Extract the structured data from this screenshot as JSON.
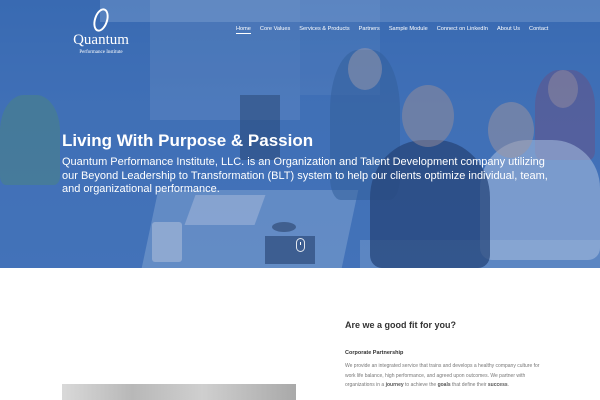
{
  "logo": {
    "name": "Quantum",
    "subtitle": "Performance Institute"
  },
  "nav": {
    "items": [
      {
        "label": "Home",
        "active": true
      },
      {
        "label": "Core Values",
        "active": false
      },
      {
        "label": "Services & Products",
        "active": false
      },
      {
        "label": "Partners",
        "active": false
      },
      {
        "label": "Sample Module",
        "active": false
      },
      {
        "label": "Connect on LinkedIn",
        "active": false
      },
      {
        "label": "About Us",
        "active": false
      },
      {
        "label": "Contact",
        "active": false
      }
    ]
  },
  "hero": {
    "title": "Living With Purpose & Passion",
    "text": "Quantum Performance Institute, LLC. is an Organization and Talent Development company utilizing our Beyond Leadership to Transformation (BLT) system to help our clients optimize individual, team, and organizational performance.",
    "overlay_color": "#2e62b0"
  },
  "fit": {
    "title": "Are we a good fit for you?",
    "subtitle": "Corporate Partnership",
    "body_part1": "We provide an integrated service that trains and develops a healthy company culture for work life balance, high performance, and agreed upon outcomes. We partner with organizations in a ",
    "body_bold1": "journey",
    "body_part2": " to achieve the ",
    "body_bold2": "goals",
    "body_part3": " that define their ",
    "body_bold3": "success",
    "body_part4": "."
  }
}
